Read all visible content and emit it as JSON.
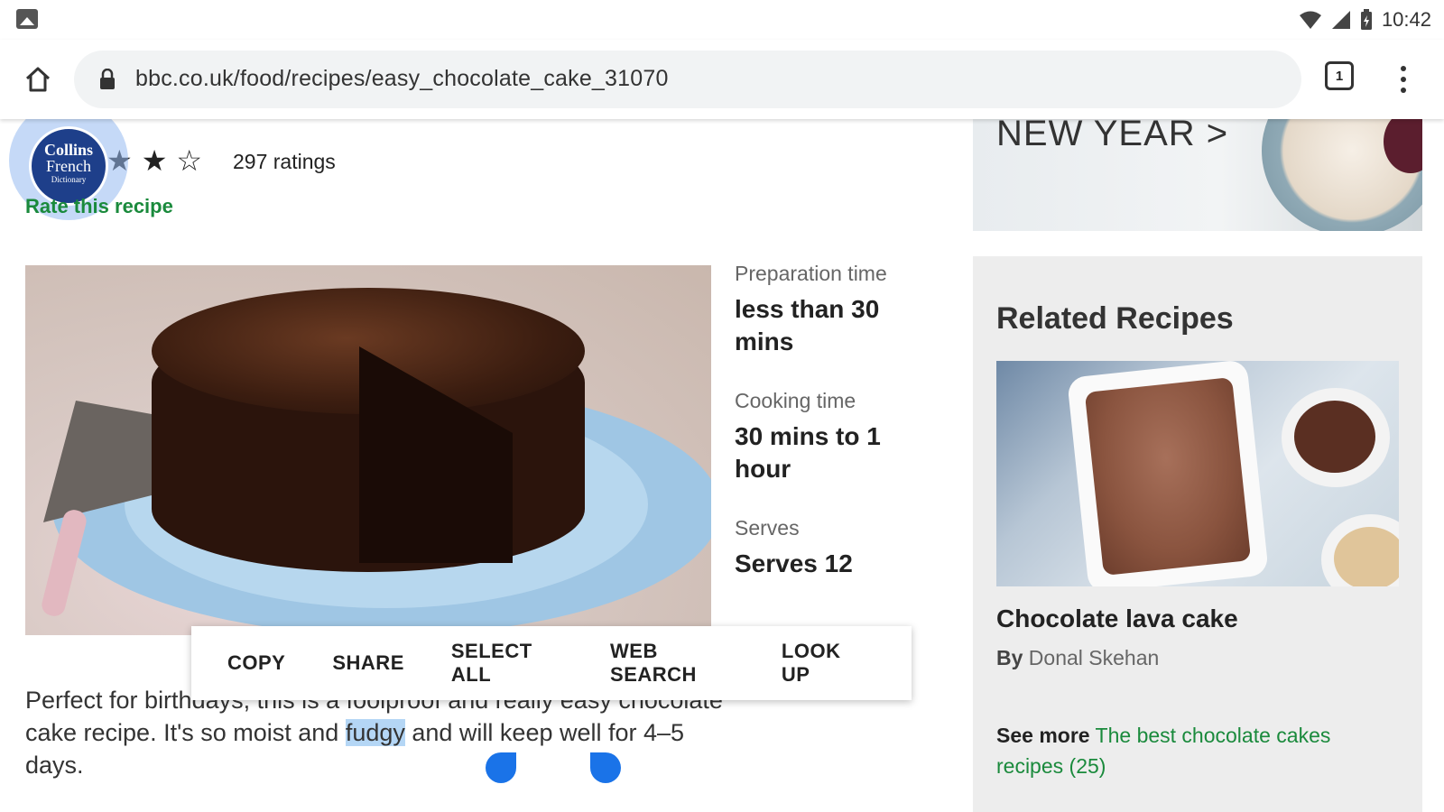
{
  "status_bar": {
    "time": "10:42"
  },
  "browser": {
    "url": "bbc.co.uk/food/recipes/easy_chocolate_cake_31070",
    "tab_count": "1"
  },
  "collins": {
    "line1": "Collins",
    "line2": "French",
    "line3": "Dictionary"
  },
  "rating": {
    "count_text": "297 ratings",
    "rate_link": "Rate this recipe"
  },
  "recipe_info": {
    "prep_label": "Preparation time",
    "prep_value": "less than 30 mins",
    "cook_label": "Cooking time",
    "cook_value": "30 mins to 1 hour",
    "serves_label": "Serves",
    "serves_value": "Serves 12"
  },
  "context_menu": {
    "copy": "COPY",
    "share": "SHARE",
    "select_all": "SELECT ALL",
    "web_search": "WEB SEARCH",
    "look_up": "LOOK UP"
  },
  "description": {
    "before": "Perfect for birthdays, this is a foolproof and really easy chocolate cake recipe. It's so moist and ",
    "selected": "fudgy",
    "after": " and will keep well for 4–5 days."
  },
  "banner": {
    "text": "NEW YEAR >"
  },
  "related": {
    "title": "Related Recipes",
    "recipe_name": "Chocolate lava cake",
    "by_label": "By",
    "author": "Donal Skehan",
    "see_more_label": "See more",
    "see_more_link": "The best chocolate cakes recipes (25)"
  },
  "colors": {
    "link_green": "#1a8a3c",
    "selection_blue": "#b4d6f5",
    "handle_blue": "#1a73e8",
    "collins_blue": "#1e3f8a"
  }
}
